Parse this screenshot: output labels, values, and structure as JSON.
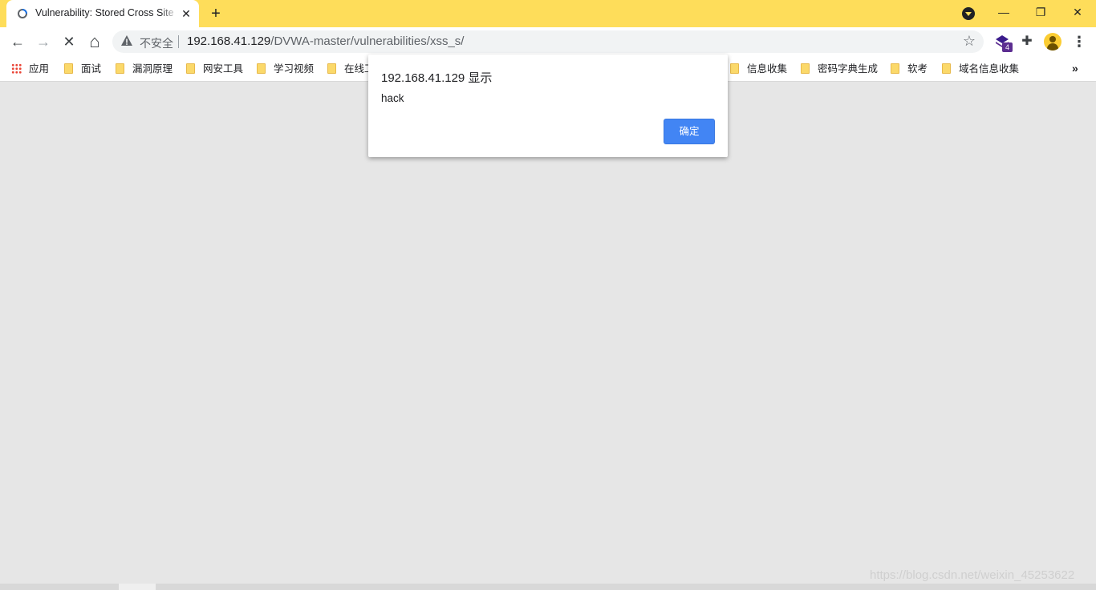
{
  "tab": {
    "title": "Vulnerability: Stored Cross Site Scripting (XSS)",
    "close_glyph": "✕",
    "new_tab_glyph": "+"
  },
  "window_controls": {
    "minimize": "—",
    "restore": "❐",
    "close": "✕"
  },
  "toolbar": {
    "back_glyph": "←",
    "forward_glyph": "→",
    "stop_glyph": "✕",
    "home_glyph": "⌂",
    "security_label": "不安全",
    "url_host": "192.168.41.129",
    "url_path": "/DVWA-master/vulnerabilities/xss_s/",
    "star_glyph": "☆",
    "extension_badge": "4",
    "menu_glyph": "⋮"
  },
  "bookmarks": {
    "apps_label": "应用",
    "items": [
      {
        "label": "面试"
      },
      {
        "label": "漏洞原理"
      },
      {
        "label": "网安工具"
      },
      {
        "label": "学习视频"
      },
      {
        "label": "在线工"
      },
      {
        "label": "信息收集"
      },
      {
        "label": "密码字典生成"
      },
      {
        "label": "软考"
      },
      {
        "label": "域名信息收集"
      }
    ],
    "more_glyph": "»"
  },
  "dialog": {
    "title": "192.168.41.129 显示",
    "message": "hack",
    "ok_label": "确定"
  },
  "watermark": "https://blog.csdn.net/weixin_45253622",
  "colors": {
    "tabstrip": "#fedd5a",
    "page_background": "#e6e6e6",
    "dialog_button": "#4285f4"
  }
}
